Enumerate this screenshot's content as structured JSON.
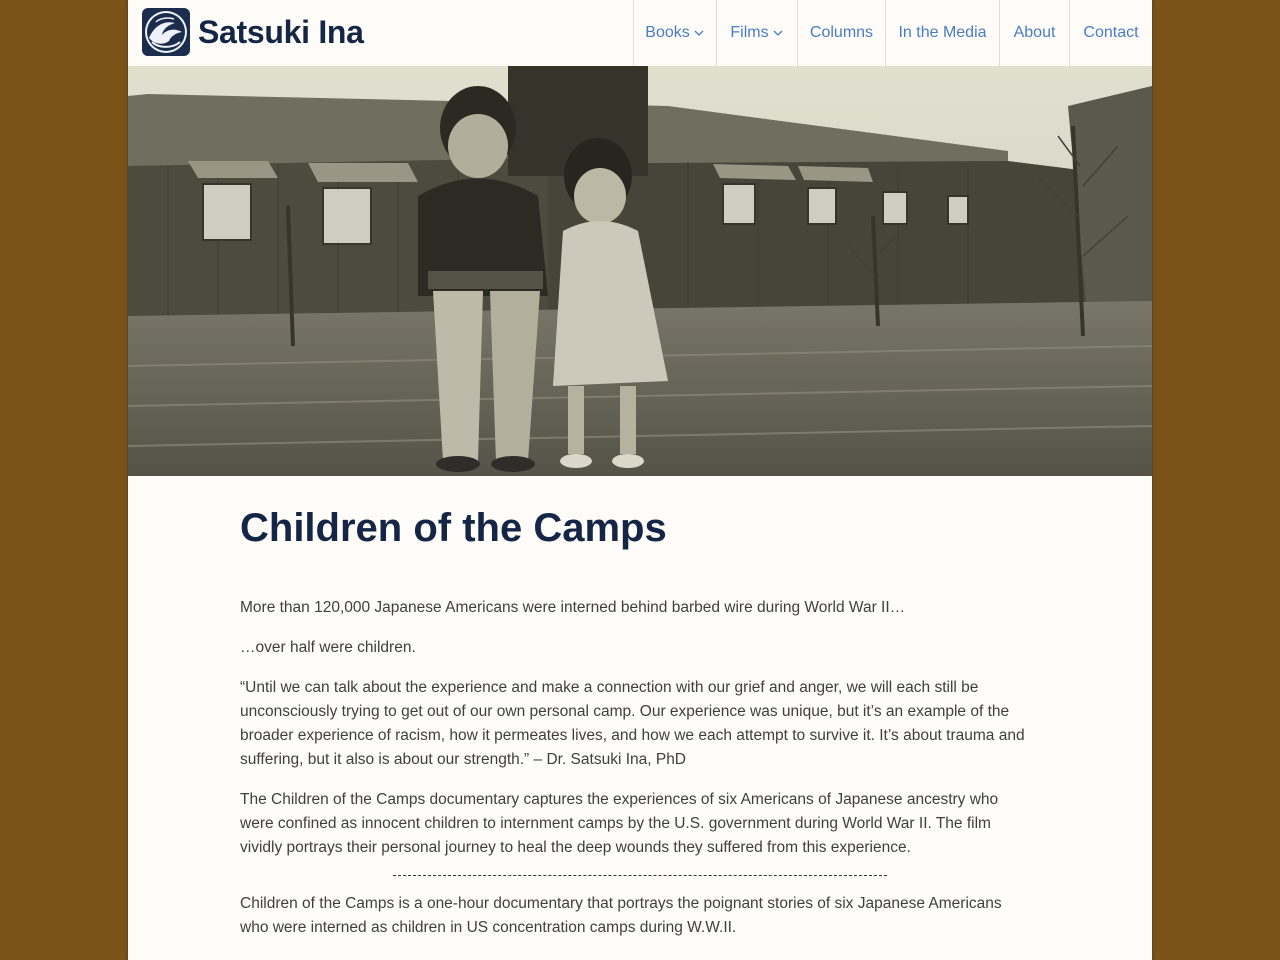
{
  "site": {
    "title": "Satsuki Ina"
  },
  "nav": {
    "items": [
      {
        "label": "Books"
      },
      {
        "label": "Films"
      },
      {
        "label": "Columns"
      },
      {
        "label": "In the Media"
      },
      {
        "label": "About"
      },
      {
        "label": "Contact"
      }
    ]
  },
  "main": {
    "title": "Children of the Camps",
    "paragraphs": [
      "More than 120,000 Japanese Americans were interned behind barbed wire during World War II…",
      "…over half were children.",
      "“Until we can talk about the experience and make a connection with our grief and anger, we will each still be unconsciously trying to get out of our own personal camp. Our experience was unique, but it’s an example of the broader experience of racism, how it permeates lives, and how we each attempt to survive it. It’s about trauma and suffering, but it also is about our strength.” – Dr. Satsuki Ina, PhD",
      "The Children of the Camps documentary captures the experiences of six Americans of Japanese ancestry who were confined as innocent children to internment camps by the U.S. government during World War II. The film vividly portrays their personal journey to heal the deep wounds they suffered from this experience.",
      "Children of the Camps is a one-hour documentary that portrays the poignant stories of six Japanese Americans who were interned as children in US concentration camps during W.W.II."
    ]
  },
  "colors": {
    "background": "#7a5319",
    "page": "#fdfcf8",
    "title": "#142546",
    "nav_link": "#4a7cc2",
    "body_text": "#3f3f3f"
  },
  "icons": {
    "logo": "wave-logo-icon",
    "dropdown": "chevron-down-icon"
  }
}
